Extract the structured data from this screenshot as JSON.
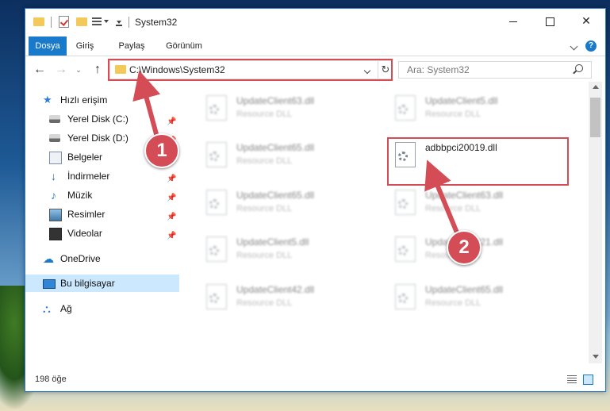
{
  "window": {
    "title": "System32",
    "controls": {
      "minimize": "",
      "maximize": "",
      "close": "✕"
    }
  },
  "ribbon": {
    "tabs": [
      "Dosya",
      "Giriş",
      "Paylaş",
      "Görünüm"
    ],
    "help": "?"
  },
  "navigation": {
    "back": "←",
    "forward": "→",
    "recent": "⌄",
    "up": "↑",
    "address": "C:\\Windows\\System32",
    "refresh": "↻",
    "search_placeholder": "Ara: System32"
  },
  "sidebar": {
    "items": [
      {
        "label": "Hızlı erişim",
        "icon": "star-icon"
      },
      {
        "label": "Yerel Disk (C:)",
        "icon": "disk-icon",
        "pinned": true
      },
      {
        "label": "Yerel Disk (D:)",
        "icon": "disk-icon",
        "pinned": true
      },
      {
        "label": "Belgeler",
        "icon": "documents-icon",
        "pinned": true
      },
      {
        "label": "İndirmeler",
        "icon": "download-icon",
        "pinned": true
      },
      {
        "label": "Müzik",
        "icon": "music-icon",
        "pinned": true
      },
      {
        "label": "Resimler",
        "icon": "pictures-icon",
        "pinned": true
      },
      {
        "label": "Videolar",
        "icon": "video-icon",
        "pinned": true
      },
      {
        "label": "OneDrive",
        "icon": "cloud-icon"
      },
      {
        "label": "Bu bilgisayar",
        "icon": "computer-icon",
        "selected": true
      },
      {
        "label": "Ağ",
        "icon": "network-icon"
      }
    ],
    "pin_glyph": "📌"
  },
  "files": [
    {
      "name": "UpdateClient63.dll",
      "type": "Resource DLL",
      "blurred": true
    },
    {
      "name": "UpdateClient5.dll",
      "type": "Resource DLL",
      "blurred": true
    },
    {
      "name": "UpdateClient65.dll",
      "type": "Resource DLL",
      "blurred": true
    },
    {
      "name": "adbbpci20019.dll",
      "type": "",
      "blurred": false
    },
    {
      "name": "UpdateClient65.dll",
      "type": "Resource DLL",
      "blurred": true
    },
    {
      "name": "UpdateClient63.dll",
      "type": "Resource DLL",
      "blurred": true
    },
    {
      "name": "UpdateClient5.dll",
      "type": "Resource DLL",
      "blurred": true
    },
    {
      "name": "UpdateClient21.dll",
      "type": "Resource DLL",
      "blurred": true
    },
    {
      "name": "UpdateClient42.dll",
      "type": "Resource DLL",
      "blurred": true
    },
    {
      "name": "UpdateClient65.dll",
      "type": "Resource DLL",
      "blurred": true
    }
  ],
  "status": {
    "item_count": "198 öğe"
  },
  "callouts": {
    "step1": "1",
    "step2": "2"
  },
  "colors": {
    "accent": "#1979ca",
    "highlight": "#d44c55",
    "selected_bg": "#cce8ff"
  }
}
